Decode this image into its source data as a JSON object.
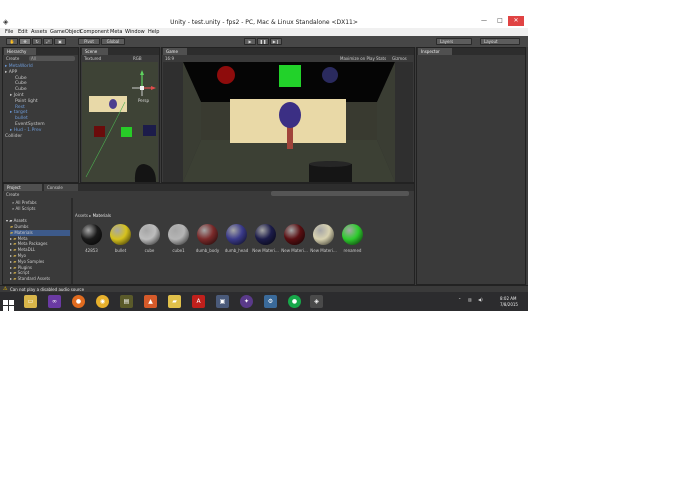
{
  "window": {
    "title": "Unity - test.unity - fps2 - PC, Mac & Linux Standalone <DX11>",
    "app_icon": "unity-logo-icon"
  },
  "menu": [
    "File",
    "Edit",
    "Assets",
    "GameObject",
    "Component",
    "Meta",
    "Window",
    "Help"
  ],
  "toolbar": {
    "pivot": "Pivot",
    "global": "Global",
    "layers": "Layers",
    "layout": "Layout"
  },
  "hierarchy": {
    "tab": "Hierarchy",
    "create": "Create",
    "search": "All",
    "items": [
      {
        "label": "MetaWorld",
        "indent": 0,
        "blue": true,
        "arrow": true
      },
      {
        "label": "APP",
        "indent": 0,
        "blue": false,
        "arrow": true
      },
      {
        "label": "Cube",
        "indent": 2,
        "blue": false,
        "arrow": false
      },
      {
        "label": "Cube",
        "indent": 2,
        "blue": false,
        "arrow": false
      },
      {
        "label": "Cube",
        "indent": 2,
        "blue": false,
        "arrow": false
      },
      {
        "label": "Joint",
        "indent": 1,
        "blue": false,
        "arrow": true
      },
      {
        "label": "Point light",
        "indent": 2,
        "blue": false,
        "arrow": false
      },
      {
        "label": "Rest",
        "indent": 2,
        "blue": true,
        "arrow": false
      },
      {
        "label": "target",
        "indent": 1,
        "blue": true,
        "arrow": true
      },
      {
        "label": "bullet",
        "indent": 2,
        "blue": true,
        "arrow": false
      },
      {
        "label": "EventSystem",
        "indent": 2,
        "blue": false,
        "arrow": false
      },
      {
        "label": "Hud - 1.Prev",
        "indent": 1,
        "blue": true,
        "arrow": true
      },
      {
        "label": "Collider",
        "indent": 0,
        "blue": false,
        "arrow": false
      }
    ]
  },
  "scene": {
    "tab": "Scene",
    "shading": "Textured",
    "rgb": "RGB",
    "persp": "Persp"
  },
  "game": {
    "tab": "Game",
    "aspect": "16:9",
    "maximize": "Maximize on Play",
    "stats": "Stats",
    "gizmos": "Gizmos"
  },
  "inspector": {
    "tab": "Inspector"
  },
  "project": {
    "tab": "Project",
    "console_tab": "Console",
    "create": "Create",
    "favorites": [
      "All Prefabs",
      "All Scripts"
    ],
    "root": "Assets",
    "folders": [
      "Dumbs",
      "Materials",
      "Meta",
      "Meta Packages",
      "MetaDLL",
      "Myo",
      "Myo Samples",
      "Plugins",
      "Script",
      "Standard Assets"
    ],
    "breadcrumb_root": "Assets",
    "breadcrumb_leaf": "Materials",
    "materials": [
      {
        "name": "42853",
        "color": "#1a1a1a"
      },
      {
        "name": "bullet",
        "color": "#d6c21e"
      },
      {
        "name": "cube",
        "color": "#bdbdbd"
      },
      {
        "name": "cube1",
        "color": "#b5b5b5"
      },
      {
        "name": "dumb_body",
        "color": "#7a2a2a"
      },
      {
        "name": "dumb_head",
        "color": "#3a3a8a"
      },
      {
        "name": "New Materi...",
        "color": "#1c1c4a"
      },
      {
        "name": "New Materi...",
        "color": "#5a0f12"
      },
      {
        "name": "New Materi...",
        "color": "#d8d2b0"
      },
      {
        "name": "renamed",
        "color": "#2ecc2e"
      }
    ]
  },
  "status": {
    "message": "Can not play a disabled audio source"
  },
  "taskbar": {
    "time": "8:02 AM",
    "date": "7/8/2015"
  }
}
